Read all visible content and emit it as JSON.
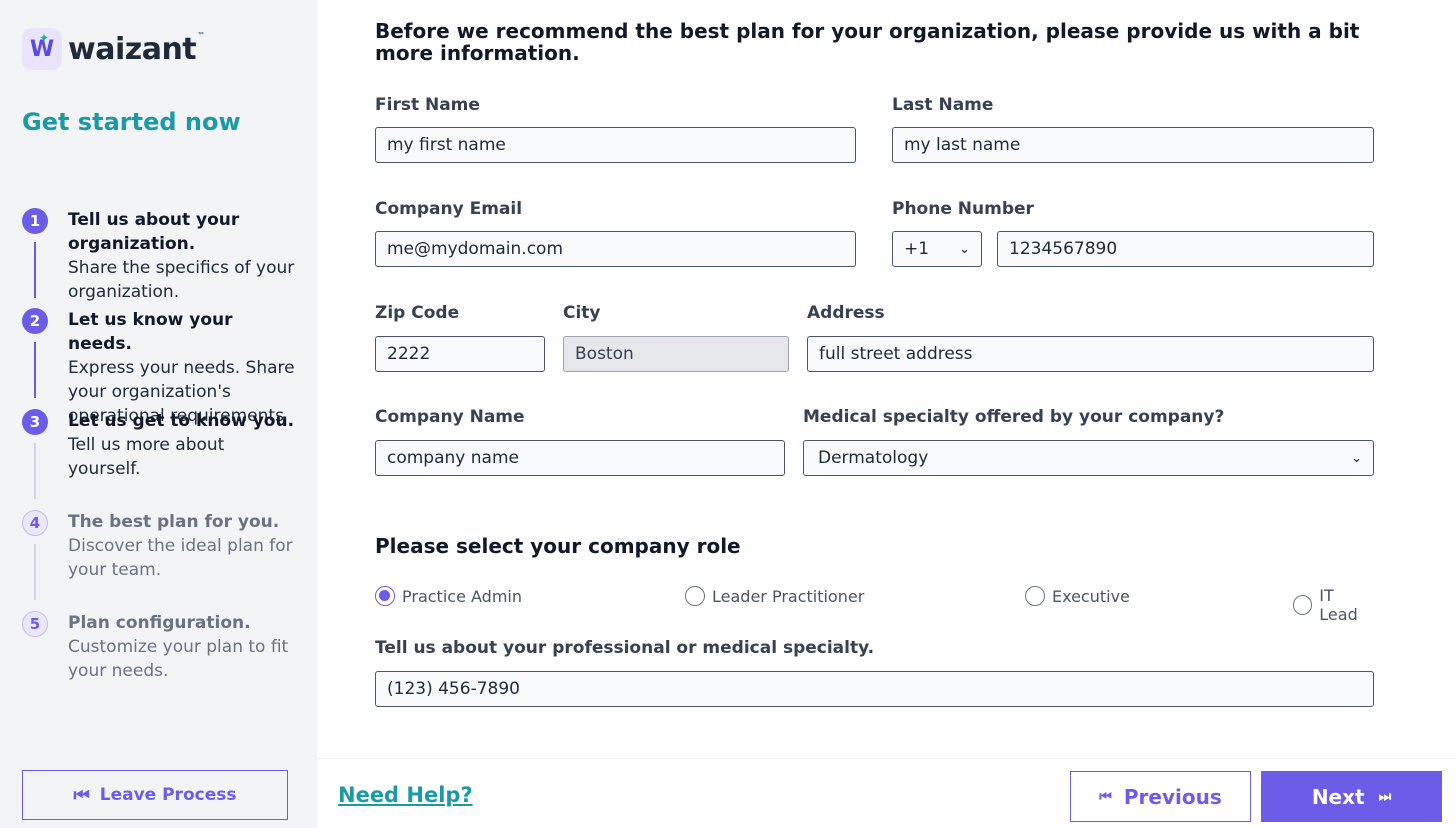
{
  "brand": {
    "name": "waizant",
    "tm": "™",
    "logo_letter": "W"
  },
  "sidebar": {
    "title": "Get started now",
    "steps": [
      {
        "num": "1",
        "title": "Tell us about your organization.",
        "desc": "Share the specifics of your organization.",
        "state": "done"
      },
      {
        "num": "2",
        "title": "Let us know your needs.",
        "desc": "Express your needs. Share your organization's operational requirements",
        "state": "done"
      },
      {
        "num": "3",
        "title": "Let us get to know you.",
        "desc": "Tell us more about yourself.",
        "state": "current"
      },
      {
        "num": "4",
        "title": "The best plan for you.",
        "desc": "Discover the ideal plan for your team.",
        "state": "upcoming"
      },
      {
        "num": "5",
        "title": "Plan configuration.",
        "desc": "Customize your plan to fit your needs.",
        "state": "upcoming"
      }
    ],
    "leave_label": "Leave Process"
  },
  "form": {
    "heading": "Before we recommend the best plan for your organization, please provide us with a bit more information.",
    "first_name": {
      "label": "First Name",
      "value": "my first name"
    },
    "last_name": {
      "label": "Last Name",
      "value": "my last name"
    },
    "email": {
      "label": "Company Email",
      "value": "me@mydomain.com"
    },
    "phone": {
      "label": "Phone Number",
      "country_code": "+1",
      "value": "1234567890"
    },
    "zip": {
      "label": "Zip Code",
      "value": "2222"
    },
    "city": {
      "label": "City",
      "value": "Boston"
    },
    "address": {
      "label": "Address",
      "value": "full street address"
    },
    "company_name": {
      "label": "Company Name",
      "value": "company name"
    },
    "specialty": {
      "label": "Medical specialty offered by your company?",
      "value": "Dermatology"
    },
    "role_heading": "Please select your company role",
    "roles": [
      {
        "label": "Practice Admin",
        "checked": true
      },
      {
        "label": "Leader Practitioner",
        "checked": false
      },
      {
        "label": "Executive",
        "checked": false
      },
      {
        "label": "IT Lead",
        "checked": false
      }
    ],
    "professional": {
      "label": "Tell us about your professional or medical specialty.",
      "value": "(123) 456-7890"
    }
  },
  "footer": {
    "help_label": "Need Help?",
    "previous_label": "Previous",
    "next_label": "Next"
  },
  "colors": {
    "accent": "#6c5ce7",
    "teal": "#1a9aa5"
  }
}
